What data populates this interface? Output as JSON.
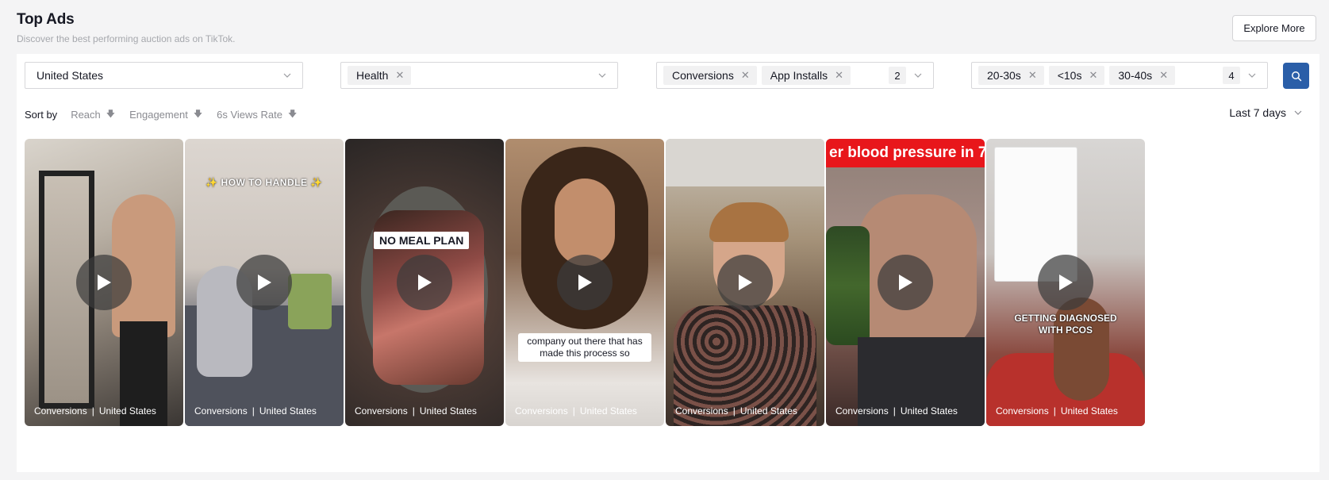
{
  "header": {
    "title": "Top Ads",
    "subtitle": "Discover the best performing auction ads on TikTok.",
    "explore_label": "Explore More"
  },
  "filters": {
    "region": "United States",
    "industry": [
      "Health"
    ],
    "objectives": [
      "Conversions",
      "App Installs"
    ],
    "objectives_count": "2",
    "durations": [
      "20-30s",
      "<10s",
      "30-40s"
    ],
    "durations_count": "4"
  },
  "sort": {
    "label": "Sort by",
    "options": [
      "Reach",
      "Engagement",
      "6s Views Rate"
    ],
    "period": "Last 7 days"
  },
  "cards": [
    {
      "objective": "Conversions",
      "region": "United States",
      "overlay": ""
    },
    {
      "objective": "Conversions",
      "region": "United States",
      "overlay": "✨ HOW TO HANDLE ✨"
    },
    {
      "objective": "Conversions",
      "region": "United States",
      "overlay": "NO MEAL PLAN"
    },
    {
      "objective": "Conversions",
      "region": "United States",
      "overlay": "company out there that has made this process so"
    },
    {
      "objective": "Conversions",
      "region": "United States",
      "overlay": ""
    },
    {
      "objective": "Conversions",
      "region": "United States",
      "overlay": "er blood pressure in 7-"
    },
    {
      "objective": "Conversions",
      "region": "United States",
      "overlay": "GETTING DIAGNOSED WITH PCOS"
    }
  ],
  "caption_separator": "|",
  "icons": {
    "chip_remove": "close-icon",
    "dropdown": "chevron-down-icon",
    "search": "search-icon",
    "sort": "arrow-down-icon",
    "play": "play-icon"
  },
  "colors": {
    "accent": "#2a5ea8",
    "page_bg": "#f4f4f5",
    "chip_bg": "#f1f1f2",
    "blood_pressure_banner": "#e8161b"
  }
}
